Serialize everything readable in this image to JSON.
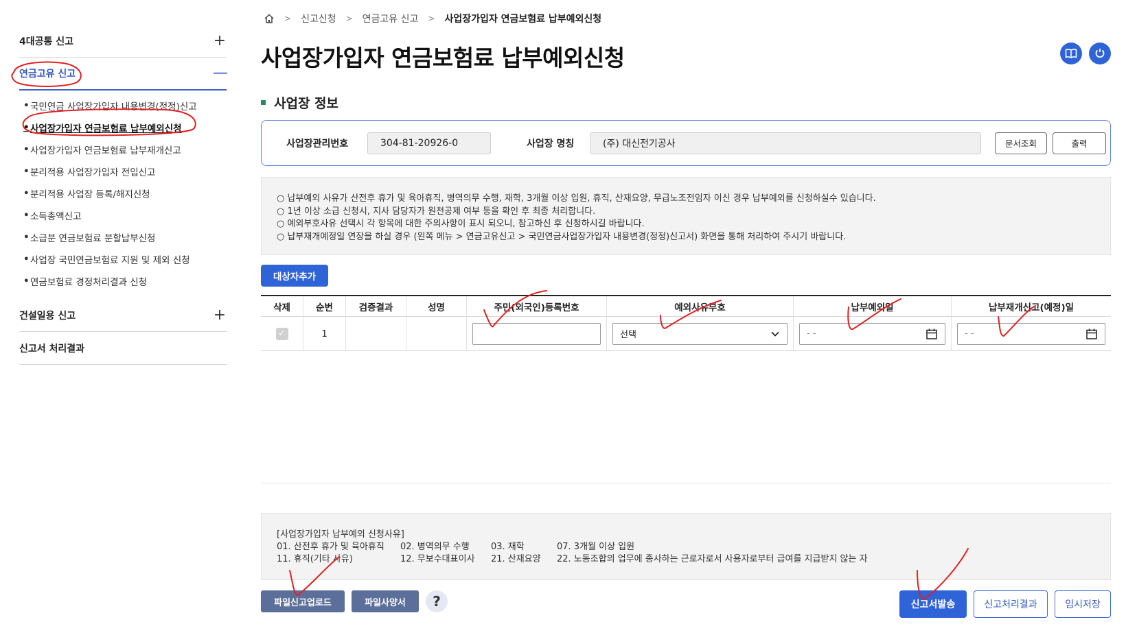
{
  "sidebar": {
    "groups": [
      {
        "label": "4대공통 신고",
        "toggle": "+"
      },
      {
        "label": "연금고유 신고",
        "toggle": "—"
      },
      {
        "label": "건설일용 신고",
        "toggle": "+"
      },
      {
        "label": "신고서 처리결과",
        "toggle": ""
      }
    ],
    "subitems": [
      "국민연금 사업장가입자 내용변경(정정)신고",
      "사업장가입자 연금보험료 납부예외신청",
      "사업장가입자 연금보험료 납부재개신고",
      "분리적용 사업장가입자 전입신고",
      "분리적용 사업장 등록/해지신청",
      "소득총액신고",
      "소급분 연금보험료 분할납부신청",
      "사업장 국민연금보험료 지원 및 제외 신청",
      "연금보험료 경정처리결과 신청"
    ],
    "bullet": "•"
  },
  "breadcrumb": {
    "items": [
      "신고신청",
      "연금고유 신고",
      "사업장가입자 연금보험료 납부예외신청"
    ],
    "sep": ">"
  },
  "page_title": "사업장가입자 연금보험료 납부예외신청",
  "section_title": "사업장 정보",
  "workplace": {
    "mgmt_no_label": "사업장관리번호",
    "mgmt_no": "304-81-20926-0",
    "name_label": "사업장 명칭",
    "name": "(주) 대신전기공사",
    "doc_lookup": "문서조회",
    "print": "출력"
  },
  "notices": [
    "○ 납부예외 사유가 산전후 휴가 및 육아휴직, 병역의무 수행, 재학, 3개월 이상 입원, 휴직, 산재요양, 무급노조전임자 이신 경우 납부예외를 신청하실수 있습니다.",
    "○ 1년 이상 소급 신청시, 지사 담당자가 원천공제 여부 등을 확인 후 최종 처리합니다.",
    "○ 예외부호사유 선택시 각 항목에 대한 주의사항이 표시 되오니, 참고하신 후 신청하시길 바랍니다.",
    "○ 납부재개예정일 연장을 하실 경우 (왼쪽 메뉴 > 연금고유신고 > 국민연금사업장가입자 내용변경(정정)신고서) 화면을 통해 처리하여 주시기 바랍니다."
  ],
  "add_target_btn": "대상자추가",
  "table": {
    "headers": [
      "삭제",
      "순번",
      "검증결과",
      "성명",
      "주민(외국인)등록번호",
      "예외사유부호",
      "납부예외일",
      "납부재개신고(예정)일"
    ],
    "row": {
      "seq": "1",
      "check": "✓",
      "reason_select": "선택",
      "date_placeholder": "- -"
    }
  },
  "reasons": {
    "title": "[사업장가입자 납부예외 신청사유]",
    "rows": [
      [
        "01. 산전후 휴가 및 육아휴직",
        "02. 병역의무 수행",
        "03. 재학",
        "07. 3개월 이상 입원"
      ],
      [
        "11. 휴직(기타 사유)",
        "12. 무보수대표이사",
        "21. 산재요양",
        "22. 노동조합의 업무에 종사하는 근로자로서 사용자로부터 급여를 지급받지 않는 자"
      ]
    ]
  },
  "bottom": {
    "file_upload": "파일신고업로드",
    "file_spec": "파일사양서",
    "help": "?",
    "send": "신고서발송",
    "result": "신고처리결과",
    "temp_save": "임시저장"
  },
  "colors": {
    "primary": "#2f63d8",
    "annotation": "#e02020",
    "section_bullet": "#2e8b57"
  }
}
